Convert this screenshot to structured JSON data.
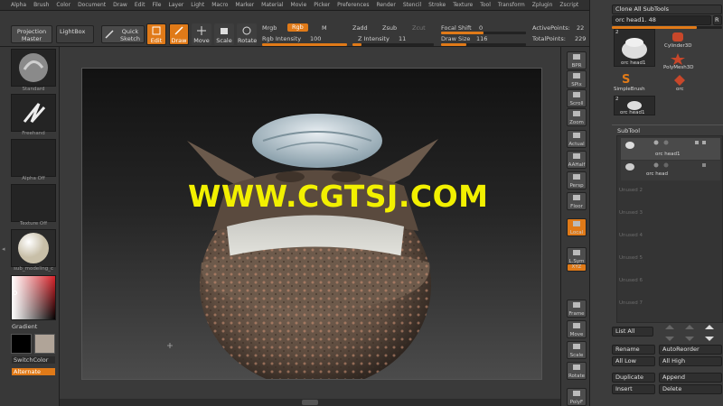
{
  "menu": [
    "Alpha",
    "Brush",
    "Color",
    "Document",
    "Draw",
    "Edit",
    "File",
    "Layer",
    "Light",
    "Macro",
    "Marker",
    "Material",
    "Movie",
    "Picker",
    "Preferences",
    "Render",
    "Stencil",
    "Stroke",
    "Texture",
    "Tool",
    "Transform",
    "Zplugin",
    "Zscript"
  ],
  "shelf": {
    "projection_master": "Projection Master",
    "lightbox": "LightBox",
    "quick_sketch": "Quick Sketch",
    "edit": "Edit",
    "draw": "Draw",
    "move": "Move",
    "scale": "Scale",
    "rotate": "Rotate",
    "mrgb": "Mrgb",
    "rgb": "Rgb",
    "m": "M",
    "rgb_intensity_label": "Rgb Intensity",
    "rgb_intensity": "100",
    "zadd": "Zadd",
    "zsub": "Zsub",
    "zcut": "Zcut",
    "z_intensity_label": "Z Intensity",
    "z_intensity": "11",
    "focal_shift_label": "Focal Shift",
    "focal_shift": "0",
    "draw_size_label": "Draw Size",
    "draw_size": "116",
    "active_points_label": "ActivePoints:",
    "active_points": "22",
    "total_points_label": "TotalPoints:",
    "total_points": "229",
    "rgb_intensity_frac": 1.0,
    "z_intensity_frac": 0.11,
    "focal_shift_frac": 0.5,
    "draw_size_frac": 0.3
  },
  "left": {
    "standard": "Standard",
    "freehand": "Freehand",
    "alpha_off": "Alpha Off",
    "texture_off": "Texture Off",
    "material": "sub_modeling_c",
    "gradient": "Gradient",
    "switchcolor": "SwitchColor",
    "alternate": "Alternate"
  },
  "watermark": "WWW.CGTSJ.COM",
  "rtool": [
    "BPR",
    "SPix",
    "Scroll",
    "Zoom",
    "Actual",
    "AAHalf",
    "Persp",
    "Floor",
    "Local",
    "L.Sym",
    "XYZ",
    "Frame",
    "Move",
    "Scale",
    "Rotate",
    "PolyF"
  ],
  "right": {
    "clone_all": "Clone  All SubTools",
    "tool_name": "orc head1. 48",
    "r": "R",
    "thumbs": {
      "big_count": "2",
      "big_label": "orc head1",
      "cylinder": "Cylinder3D",
      "polymesh": "PolyMesh3D",
      "simplebrush": "SimpleBrush",
      "orc": "orc",
      "small_count": "2",
      "small_label": "orc head1"
    },
    "subtool_title": "SubTool",
    "subtool_item1": "orc head1",
    "subtool_item2": "orc head",
    "empty_slots": [
      "Unused 2",
      "Unused 3",
      "Unused 4",
      "Unused 5",
      "Unused 6",
      "Unused 7"
    ],
    "list_all": "List All",
    "rename": "Rename",
    "autoreorder": "AutoReorder",
    "all_low": "All Low",
    "all_high": "All High",
    "duplicate": "Duplicate",
    "append": "Append",
    "insert": "Insert",
    "delete": "Delete"
  },
  "colors": {
    "accent": "#e07a18",
    "watermark": "#f2f000",
    "panel": "#3c3c3c"
  }
}
